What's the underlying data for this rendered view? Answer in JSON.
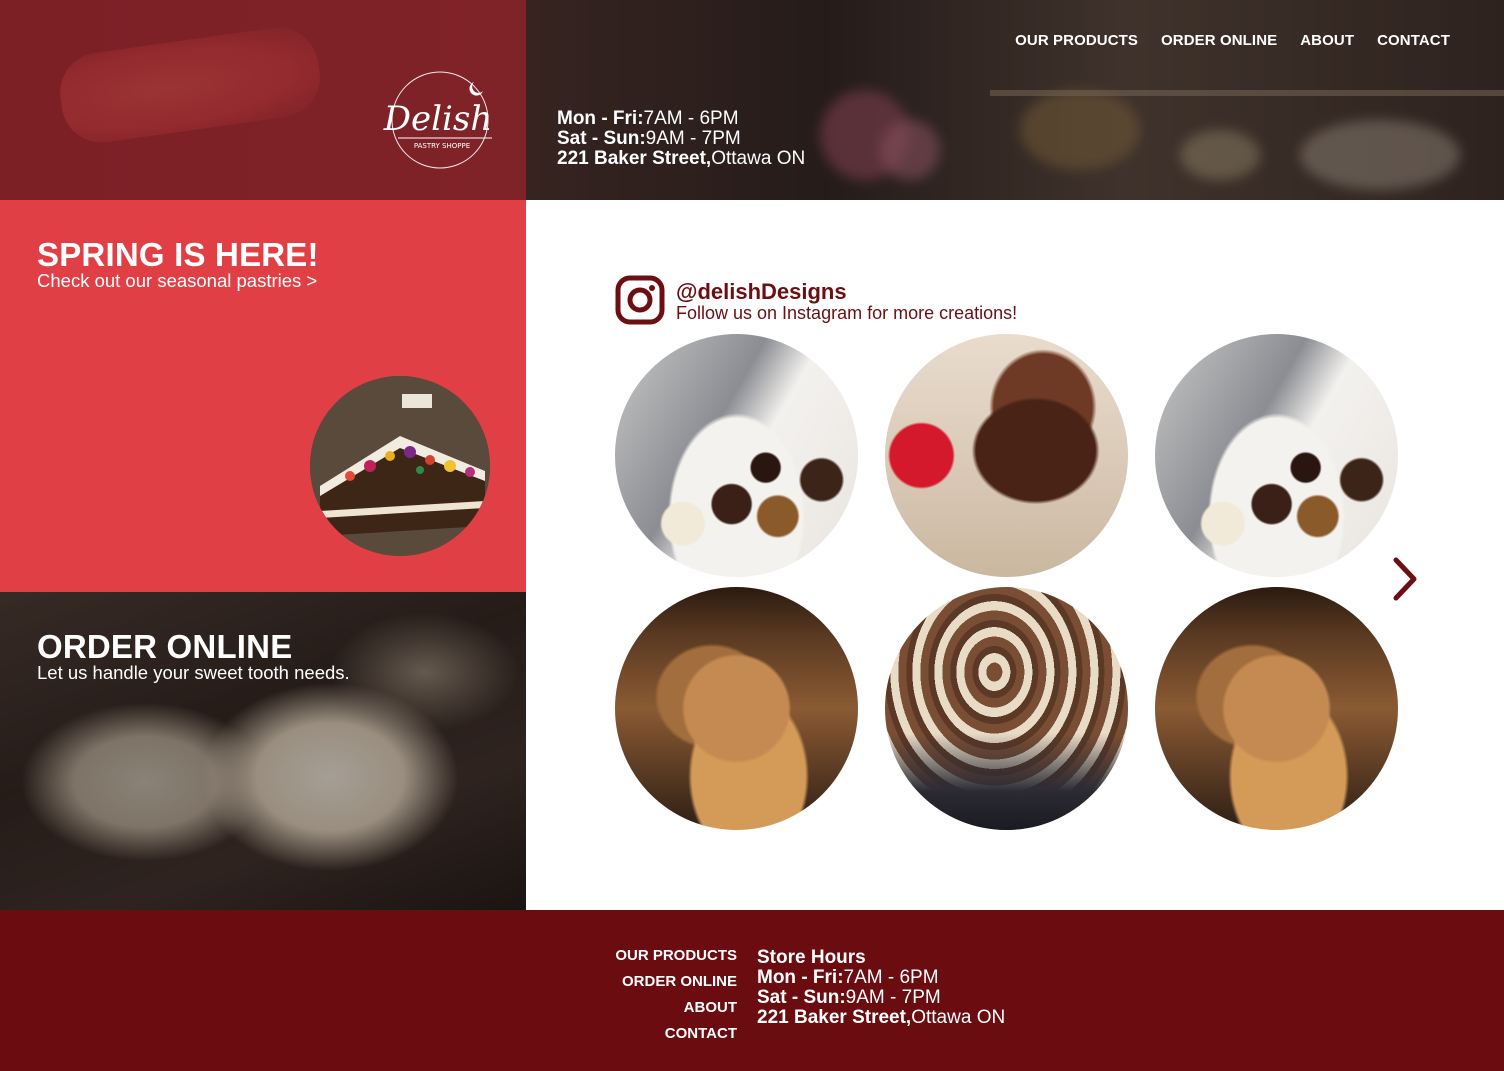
{
  "brand": {
    "name": "Delish",
    "tagline": "PASTRY SHOPPE"
  },
  "nav": [
    {
      "label": "OUR PRODUCTS"
    },
    {
      "label": "ORDER ONLINE"
    },
    {
      "label": "ABOUT"
    },
    {
      "label": "CONTACT"
    }
  ],
  "hours": {
    "weekday_label": "Mon - Fri:",
    "weekday_time": "7AM - 6PM",
    "weekend_label": "Sat - Sun:",
    "weekend_time": "9AM - 7PM",
    "address_label": "221 Baker Street,",
    "address_city": "Ottawa ON"
  },
  "spring": {
    "title": "SPRING IS HERE!",
    "subtitle": "Check out our seasonal pastries >"
  },
  "order": {
    "title": "ORDER ONLINE",
    "subtitle": "Let us handle your sweet tooth needs."
  },
  "instagram": {
    "handle": "@delishDesigns",
    "subtitle": "Follow us on Instagram for more creations!"
  },
  "footer": {
    "nav": [
      {
        "label": "OUR PRODUCTS"
      },
      {
        "label": "ORDER ONLINE"
      },
      {
        "label": "ABOUT"
      },
      {
        "label": "CONTACT"
      }
    ],
    "store_hours_title": "Store Hours"
  },
  "colors": {
    "brand_red": "#e03f46",
    "dark_red": "#6b0c10",
    "accent": "#6b0f12"
  }
}
